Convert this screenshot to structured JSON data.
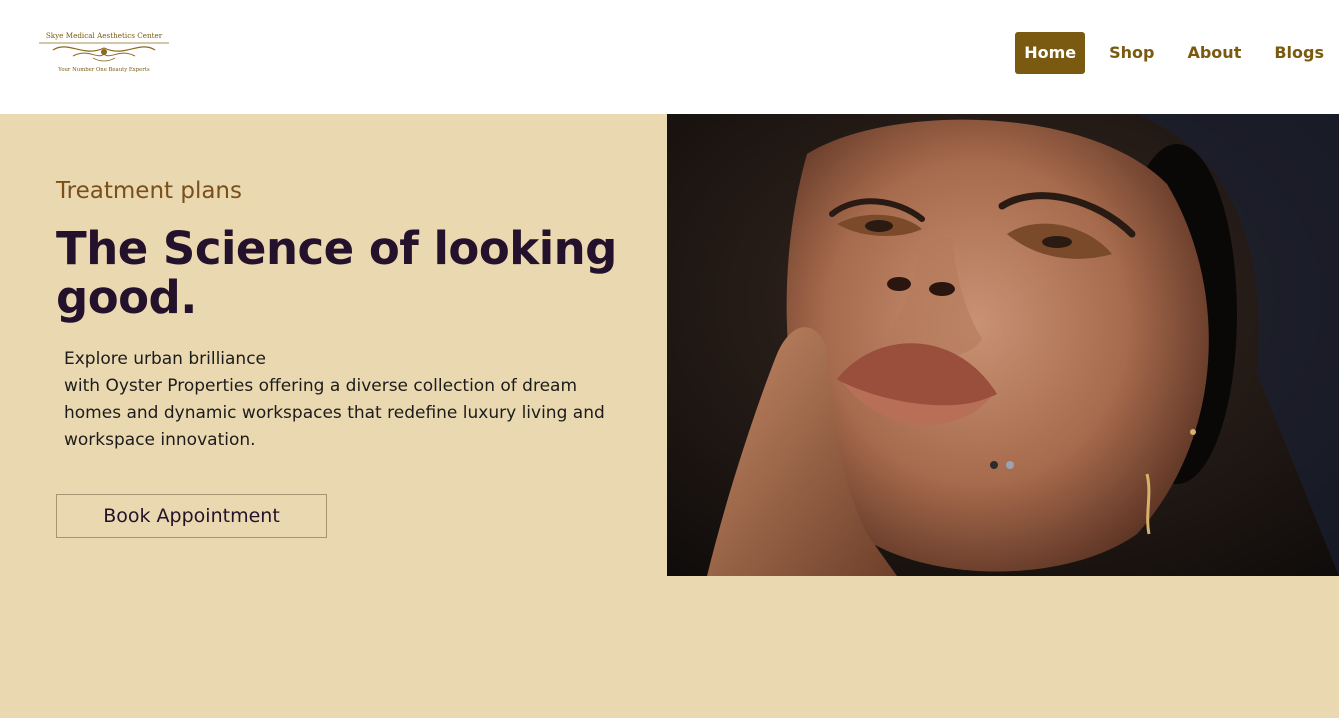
{
  "logo": {
    "name": "Skye Medical Aesthetics Center",
    "tagline": "Your Number One Beauty Experts"
  },
  "nav": {
    "items": [
      {
        "label": "Home",
        "active": true
      },
      {
        "label": "Shop",
        "active": false
      },
      {
        "label": "About",
        "active": false
      },
      {
        "label": "Blogs",
        "active": false
      }
    ]
  },
  "hero": {
    "eyebrow": "Treatment plans",
    "headline": "The Science of looking good.",
    "body_line1": "Explore urban brilliance",
    "body_line2": "with Oyster Properties offering a diverse collection of dream homes and dynamic workspaces that redefine luxury living and workspace innovation.",
    "cta_label": "Book Appointment",
    "slides": {
      "count": 2,
      "active": 1
    }
  },
  "colors": {
    "background": "#ead8b0",
    "brand_gold": "#7a5a10",
    "headline": "#24112b",
    "eyebrow": "#7a4f1a"
  }
}
